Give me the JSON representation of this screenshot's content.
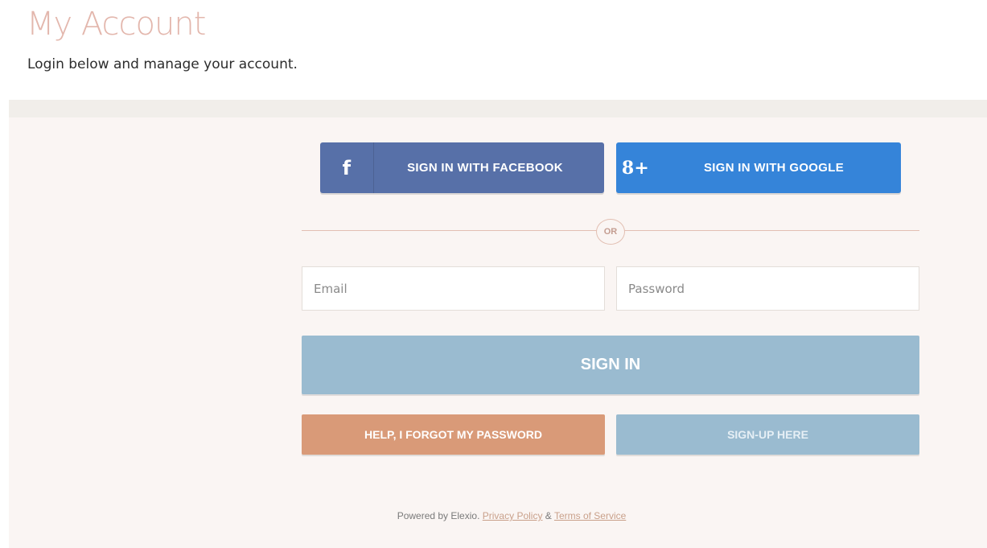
{
  "header": {
    "title": "My Account",
    "subtitle": "Login below and manage your account."
  },
  "social": {
    "facebook_label": "SIGN IN WITH FACEBOOK",
    "facebook_icon": "f",
    "google_label": "SIGN IN WITH GOOGLE",
    "google_icon": "8+"
  },
  "divider": {
    "or_label": "OR"
  },
  "form": {
    "email_placeholder": "Email",
    "email_value": "",
    "password_placeholder": "Password",
    "password_value": "",
    "signin_label": "SIGN IN",
    "forgot_label": "HELP, I FORGOT MY PASSWORD",
    "signup_label": "SIGN-UP HERE"
  },
  "footer": {
    "powered_text": "Powered by Elexio.",
    "privacy_label": "Privacy Policy",
    "amp": "&",
    "terms_label": "Terms of Service"
  },
  "colors": {
    "title": "#e3b7ad",
    "facebook": "#5770a8",
    "google": "#3584d9",
    "signin": "#9abbd0",
    "forgot": "#d99a78",
    "panel": "#faf5f3"
  }
}
